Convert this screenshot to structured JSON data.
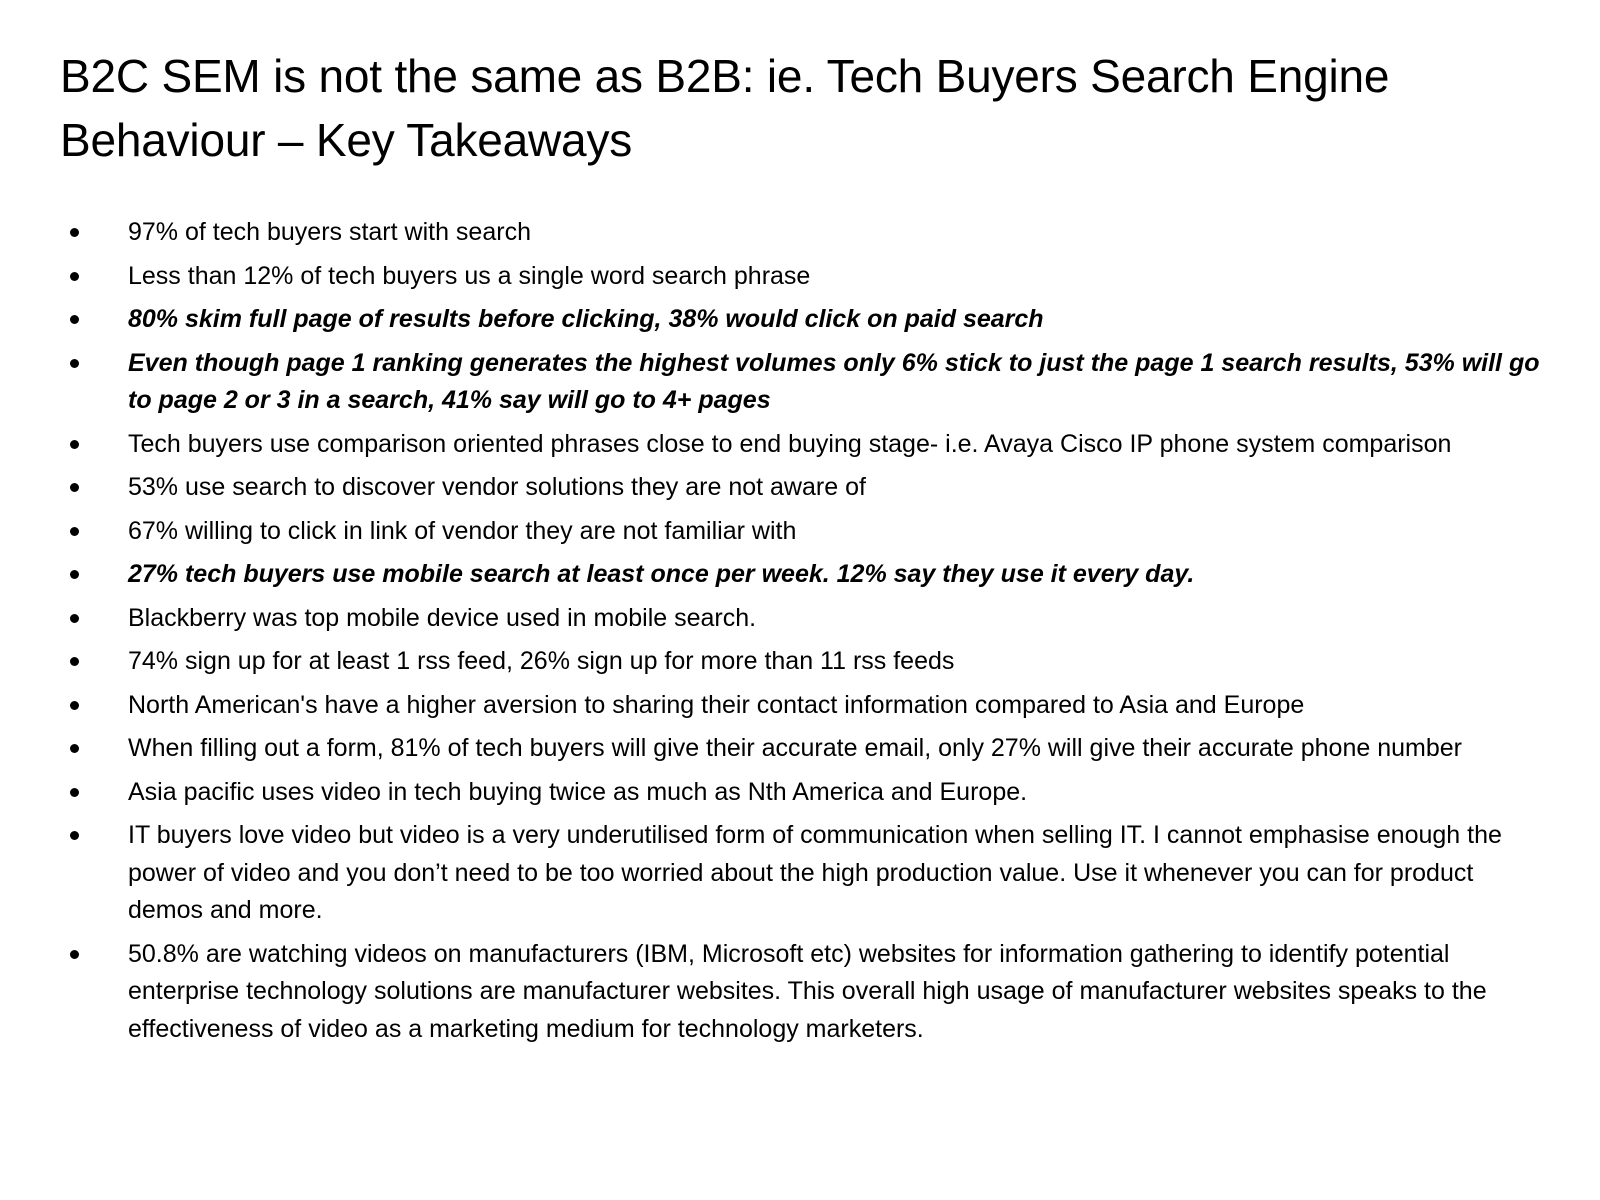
{
  "slide": {
    "title_line1": "B2C SEM is not the same as B2B: ie. Tech Buyers Search Engine",
    "title_line2": "Behaviour – Key Takeaways",
    "bullets": [
      "97% of tech buyers start with search",
      "Less than 12% of tech buyers us a single word search phrase",
      "80% skim full page of results before clicking, 38% would click on paid search",
      "Even though page 1 ranking generates the highest volumes only 6% stick to just the page 1 search results, 53% will go to page 2 or 3 in a search, 41% say will go to 4+ pages",
      "Tech buyers use comparison oriented phrases close to end buying stage- i.e. Avaya Cisco IP phone system comparison",
      "53% use search to discover vendor solutions they are not aware of",
      "67% willing to click in link of vendor they are not familiar with",
      "27% tech buyers use mobile search at least once per week. 12% say they use it every day.",
      "Blackberry was top mobile device used in mobile search.",
      "74% sign up for at least 1 rss feed, 26% sign up for more than 11 rss feeds",
      "North American's have a higher aversion to sharing their contact information compared to Asia and Europe",
      "When filling out a form, 81% of tech buyers will give their accurate email, only 27% will give their accurate phone number",
      "Asia pacific uses video in tech buying twice as much as Nth America and Europe.",
      "IT buyers love video but video is a very underutilised form of communication when selling IT. I cannot emphasise enough the power of video and you don’t need to be too worried about the high production value. Use it whenever you can for product demos and more.",
      "50.8% are watching videos on manufacturers (IBM, Microsoft etc) websites for information gathering to identify potential enterprise technology solutions are manufacturer websites. This overall high usage of manufacturer websites speaks to the effectiveness of video as a marketing medium for technology marketers."
    ]
  }
}
